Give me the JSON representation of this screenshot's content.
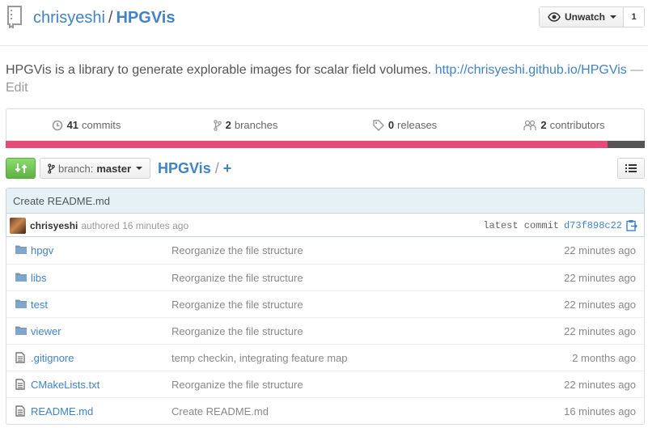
{
  "header": {
    "owner": "chrisyeshi",
    "separator": "/",
    "repo": "HPGVis",
    "watch_label": "Unwatch",
    "watch_count": "1"
  },
  "description": {
    "text": "HPGVis is a library to generate explorable images for scalar field volumes.",
    "link": "http://chrisyeshi.github.io/HPGVis",
    "dash": "—",
    "edit": "Edit"
  },
  "summary": {
    "commits_count": "41",
    "commits_label": "commits",
    "branches_count": "2",
    "branches_label": "branches",
    "releases_count": "0",
    "releases_label": "releases",
    "contributors_count": "2",
    "contributors_label": "contributors"
  },
  "language_colors": {
    "primary": "#e44b7a",
    "secondary": "#555555"
  },
  "toolbar": {
    "branch_prefix": "branch:",
    "branch_value": "master",
    "breadcrumb_root": "HPGVis",
    "breadcrumb_sep": "/",
    "breadcrumb_add": "+"
  },
  "commit": {
    "message": "Create README.md",
    "author": "chrisyeshi",
    "authored": "authored 16 minutes ago",
    "latest_label": "latest commit",
    "sha": "d73f898c22"
  },
  "files": [
    {
      "type": "dir",
      "icon": "folder-icon",
      "name": "hpgv",
      "message": "Reorganize the file structure",
      "age": "22 minutes ago"
    },
    {
      "type": "dir",
      "icon": "folder-icon",
      "name": "libs",
      "message": "Reorganize the file structure",
      "age": "22 minutes ago"
    },
    {
      "type": "dir",
      "icon": "folder-icon",
      "name": "test",
      "message": "Reorganize the file structure",
      "age": "22 minutes ago"
    },
    {
      "type": "dir",
      "icon": "folder-icon",
      "name": "viewer",
      "message": "Reorganize the file structure",
      "age": "22 minutes ago"
    },
    {
      "type": "file",
      "icon": "file-icon",
      "name": ".gitignore",
      "message": "temp checkin, integrating feature map",
      "age": "2 months ago"
    },
    {
      "type": "file",
      "icon": "file-icon",
      "name": "CMakeLists.txt",
      "message": "Reorganize the file structure",
      "age": "22 minutes ago"
    },
    {
      "type": "file",
      "icon": "file-icon",
      "name": "README.md",
      "message": "Create README.md",
      "age": "16 minutes ago"
    }
  ]
}
